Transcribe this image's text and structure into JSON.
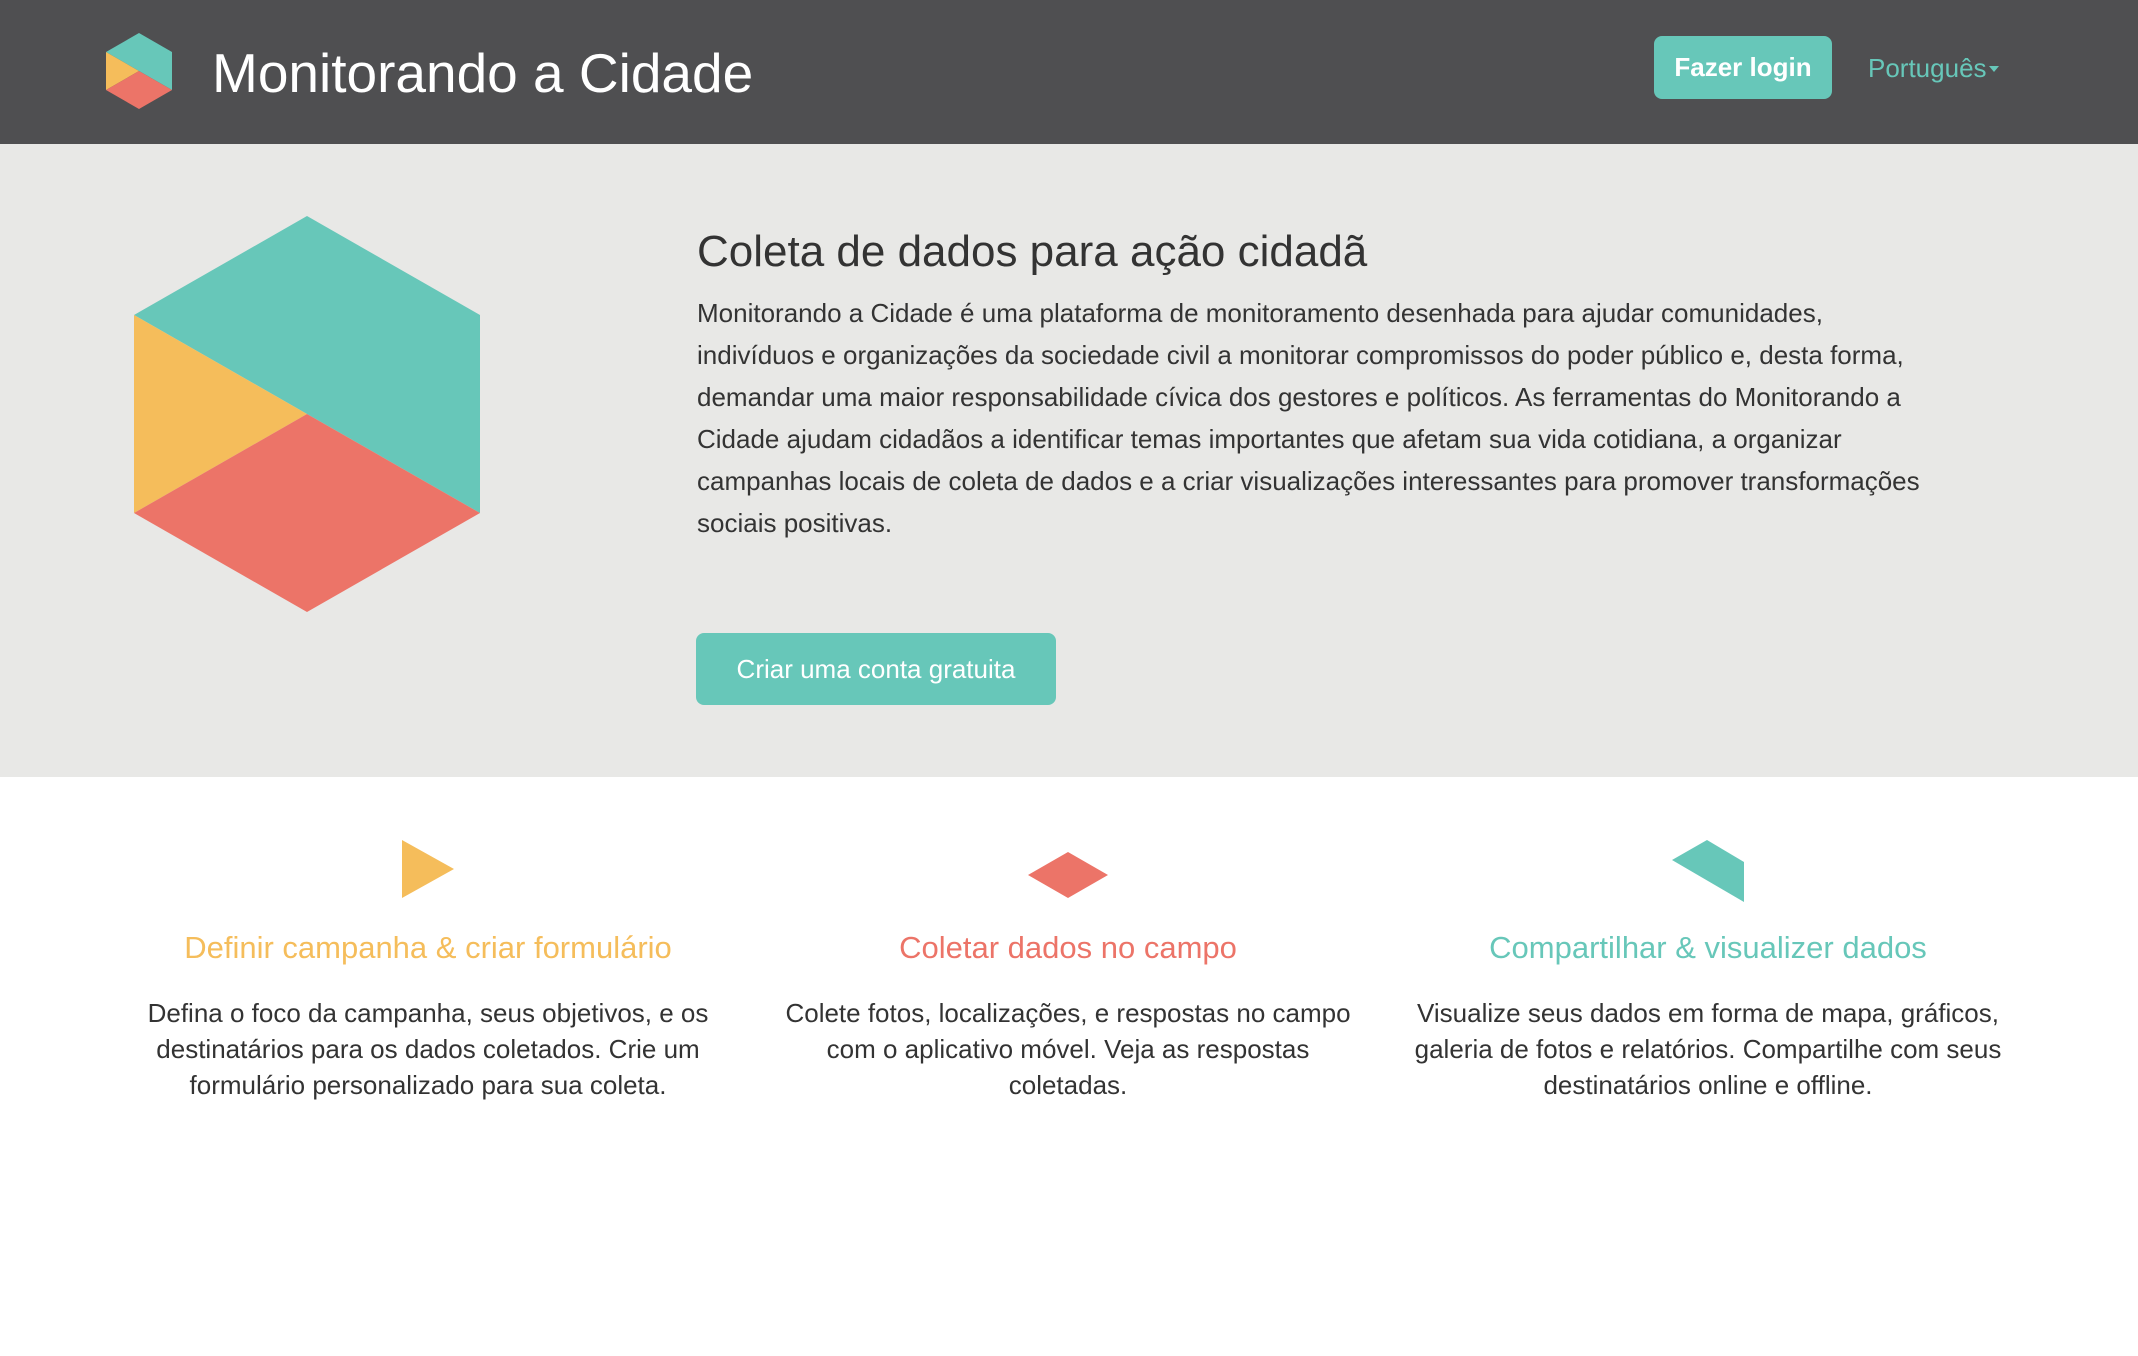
{
  "colors": {
    "teal": "#67c7b9",
    "yellow": "#f5bd5b",
    "coral": "#ec7468",
    "header_bg": "#4f4f51",
    "hero_bg": "#e8e8e6"
  },
  "header": {
    "logo_icon": "hexagon-logo-icon",
    "title": "Monitorando a Cidade",
    "login_label": "Fazer login",
    "language": "Português"
  },
  "hero": {
    "logo_icon": "hexagon-logo-icon",
    "title": "Coleta de dados para ação cidadã",
    "text": "Monitorando a Cidade é uma plataforma de monitoramento desenhada para ajudar comunidades, indivíduos e organizações da sociedade civil a monitorar compromissos do poder público e, desta forma, demandar uma maior responsabilidade cívica dos gestores e políticos. As ferramentas do Monitorando a Cidade ajudam cidadãos a identificar temas importantes que afetam sua vida cotidiana, a organizar campanhas locais de coleta de dados e a criar visualizações interessantes para promover transformações sociais positivas.",
    "signup_label": "Criar uma conta gratuita"
  },
  "features": [
    {
      "icon": "yellow-triangle-icon",
      "title": "Definir campanha & criar formulário",
      "text": "Defina o foco da campanha, seus objetivos, e os destinatários para os dados coletados. Crie um formulário personalizado para sua coleta."
    },
    {
      "icon": "coral-diamond-icon",
      "title": "Coletar dados no campo",
      "text": "Colete fotos, localizações, e respostas no campo com o aplicativo móvel. Veja as respostas coletadas."
    },
    {
      "icon": "teal-shape-icon",
      "title": "Compartilhar & visualizer dados",
      "text": "Visualize seus dados em forma de mapa, gráficos, galeria de fotos e relatórios. Compartilhe com seus destinatários online e offline."
    }
  ]
}
